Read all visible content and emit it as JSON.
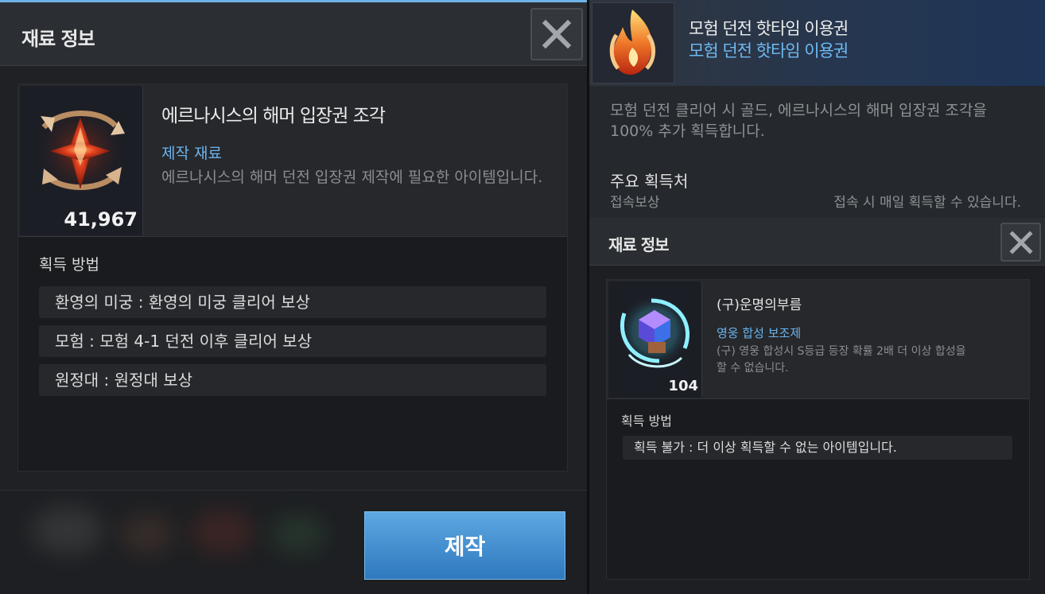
{
  "left_panel": {
    "title": "재료 정보",
    "close_icon": "close-icon",
    "item": {
      "count": "41,967",
      "name": "에르나시스의 해머 입장권 조각",
      "category": "제작 재료",
      "description": "에르나시스의 해머 던전 입장권 제작에 필요한 아이템입니다.",
      "icon": "hammer-ticket-shard-icon"
    },
    "acquisition_label": "획득 방법",
    "acquisition": [
      "환영의 미궁 : 환영의 미궁 클리어 보상",
      "모험 : 모험 4-1 던전 이후 클리어 보상",
      "원정대 : 원정대 보상"
    ],
    "craft_button": "제작"
  },
  "right_panel": {
    "ticket": {
      "title": "모험 던전 핫타임 이용권",
      "subtitle": "모험 던전 핫타임 이용권",
      "icon": "flame-ticket-icon",
      "description": "모험 던전 클리어 시 골드, 에르나시스의 해머 입장권 조각을 100% 추가 획득합니다.",
      "source_label": "주요 획득처",
      "source_name": "접속보상",
      "source_detail": "접속 시 매일 획득할 수 있습니다."
    },
    "sub_panel": {
      "title": "재료 정보",
      "close_icon": "close-icon",
      "item": {
        "count": "104",
        "name": "(구)운명의부름",
        "category": "영웅 합성 보조제",
        "description": "(구) 영웅 합성시 S등급 등장 확률 2배 더 이상 합성을 할 수 없습니다.",
        "icon": "fate-call-icon"
      },
      "acquisition_label": "획득 방법",
      "acquisition": [
        "획득 불가 : 더 이상 획득할 수 없는 아이템입니다."
      ]
    }
  },
  "colors": {
    "accent_blue": "#6cb4ee",
    "button_blue": "#3f8bd0",
    "panel_dark": "#1f2125"
  }
}
